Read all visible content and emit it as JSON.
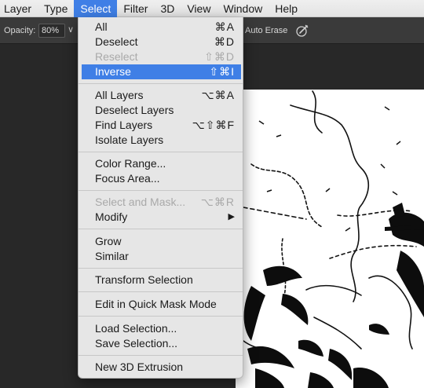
{
  "menubar": {
    "items": [
      "Layer",
      "Type",
      "Select",
      "Filter",
      "3D",
      "View",
      "Window",
      "Help"
    ]
  },
  "options": {
    "opacity_label": "Opacity:",
    "opacity_value": "80%",
    "auto_erase_label": "Auto Erase"
  },
  "select_menu": {
    "all": {
      "label": "All",
      "shortcut": "⌘A"
    },
    "deselect": {
      "label": "Deselect",
      "shortcut": "⌘D"
    },
    "reselect": {
      "label": "Reselect",
      "shortcut": "⇧⌘D"
    },
    "inverse": {
      "label": "Inverse",
      "shortcut": "⇧⌘I"
    },
    "all_layers": {
      "label": "All Layers",
      "shortcut": "⌥⌘A"
    },
    "deselect_layers": {
      "label": "Deselect Layers"
    },
    "find_layers": {
      "label": "Find Layers",
      "shortcut": "⌥⇧⌘F"
    },
    "isolate_layers": {
      "label": "Isolate Layers"
    },
    "color_range": {
      "label": "Color Range..."
    },
    "focus_area": {
      "label": "Focus Area..."
    },
    "select_and_mask": {
      "label": "Select and Mask...",
      "shortcut": "⌥⌘R"
    },
    "modify": {
      "label": "Modify"
    },
    "grow": {
      "label": "Grow"
    },
    "similar": {
      "label": "Similar"
    },
    "transform_selection": {
      "label": "Transform Selection"
    },
    "quick_mask": {
      "label": "Edit in Quick Mask Mode"
    },
    "load_selection": {
      "label": "Load Selection..."
    },
    "save_selection": {
      "label": "Save Selection..."
    },
    "new_3d_extrusion": {
      "label": "New 3D Extrusion"
    }
  },
  "icons": {
    "submenu_arrow": "triangle-right-icon",
    "brush_icon": "brush-pressure-icon",
    "dropdown_icon": "chevron-down-icon"
  },
  "colors": {
    "highlight": "#3f7fe6",
    "menu_bg": "#e6e6e6",
    "disabled_text": "#a9a9a9"
  }
}
